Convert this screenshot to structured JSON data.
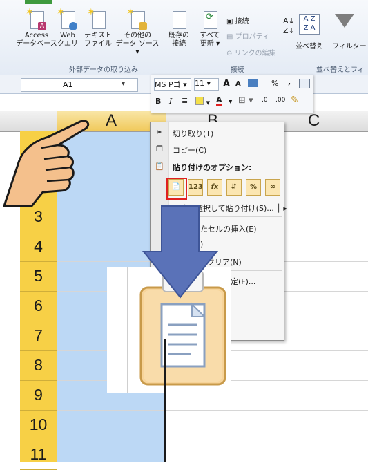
{
  "ribbon": {
    "buttons": [
      {
        "label1": "Access",
        "label2": "データベース"
      },
      {
        "label1": "Web",
        "label2": "クエリ"
      },
      {
        "label1": "テキスト",
        "label2": "ファイル"
      },
      {
        "label1": "その他の",
        "label2": "データ ソース ▾"
      },
      {
        "label1": "既存の",
        "label2": "接続"
      },
      {
        "label1": "すべて",
        "label2": "更新 ▾"
      }
    ],
    "group_external": "外部データの取り込み",
    "group_connection": "接続",
    "group_sort": "並べ替えとフィルタ",
    "conn_items": [
      "接続",
      "プロパティ",
      "リンクの編集"
    ],
    "sort_label": "並べ替え",
    "filter_label": "フィルター"
  },
  "namebox": {
    "value": "A1"
  },
  "columns": [
    "A",
    "B",
    "C"
  ],
  "rows": [
    "3",
    "4",
    "5",
    "6",
    "7",
    "8",
    "9",
    "10",
    "11"
  ],
  "mini_toolbar": {
    "font": "MS Pゴ ▾",
    "size": "11",
    "grow": "A",
    "shrink": "A",
    "percent": "%",
    "comma": ",",
    "bold": "B",
    "italic": "I",
    "center": "≣",
    "font_color": "A",
    "dec_inc": ".0",
    "dec_dec": ".00"
  },
  "context_menu": {
    "cut": "切り取り(T)",
    "copy": "コピー(C)",
    "paste_options": "貼り付けのオプション:",
    "paste_buttons": [
      "",
      "123",
      "fx",
      "",
      "%",
      "∞"
    ],
    "paste_special": "形式を選択して貼り付け(S)...",
    "insert": "たセルの挿入(E)",
    "delete": ")",
    "clear": "クリア(N)",
    "format": "の書式設定(F)..."
  },
  "colors": {
    "accent_red": "#e02020",
    "arrow_blue": "#5a72b8",
    "row_header": "#f7d046",
    "selected_col": "#bcd8f5"
  }
}
